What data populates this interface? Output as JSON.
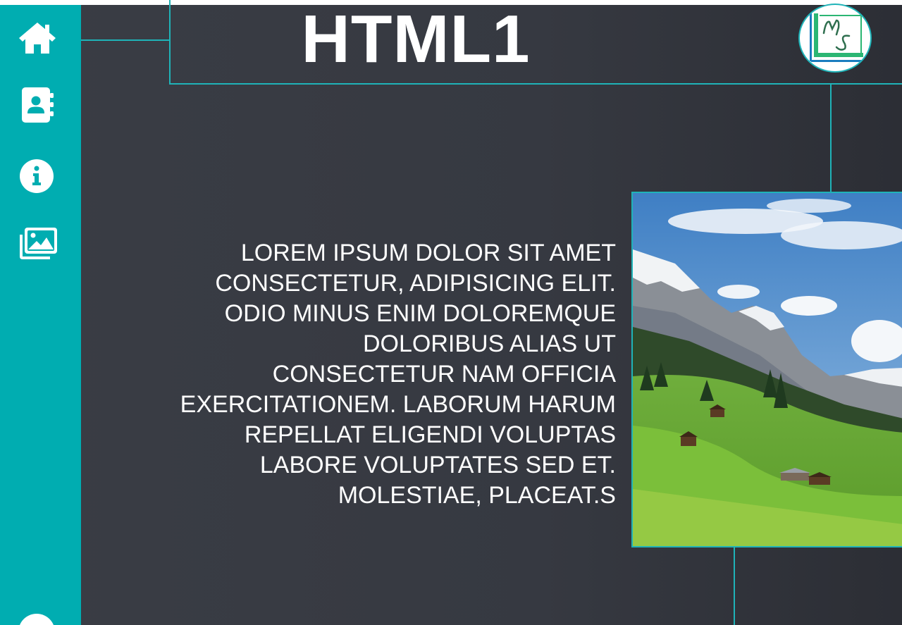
{
  "header": {
    "title": "HTML1"
  },
  "logo": {
    "icon": "ms-logo",
    "letters": "MS"
  },
  "sidebar": {
    "items": [
      {
        "name": "home",
        "icon": "home-icon"
      },
      {
        "name": "contacts",
        "icon": "address-book-icon"
      },
      {
        "name": "info",
        "icon": "info-icon"
      },
      {
        "name": "gallery",
        "icon": "images-icon"
      }
    ]
  },
  "main": {
    "paragraph": "LOREM IPSUM DOLOR SIT AMET CONSECTETUR, ADIPISICING ELIT. ODIO MINUS ENIM DOLOREMQUE DOLORIBUS ALIAS UT CONSECTETUR NAM OFFICIA EXERCITATIONEM. LABORUM HARUM REPELLAT ELIGENDI VOLUPTAS LABORE VOLUPTATES SED ET. MOLESTIAE, PLACEAT.S",
    "image": "mountain-valley-photo"
  },
  "colors": {
    "sidebar": "#00adb1",
    "background": "#3a3d45",
    "accent_line": "#1fb3b8",
    "text": "#ffffff"
  }
}
